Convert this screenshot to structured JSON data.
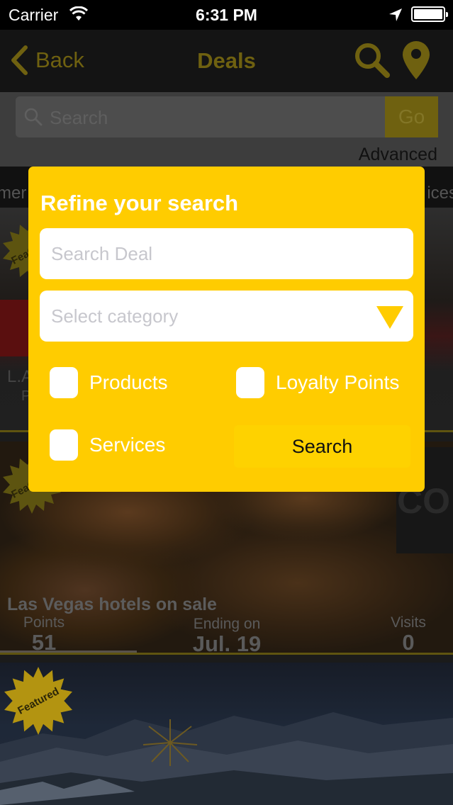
{
  "status_bar": {
    "carrier": "Carrier",
    "time": "6:31 PM",
    "wifi_icon": "wifi-icon",
    "location_icon": "location-arrow-icon",
    "battery_icon": "battery-icon"
  },
  "nav": {
    "back_label": "Back",
    "title": "Deals",
    "search_icon": "search-icon",
    "location_icon": "map-pin-icon"
  },
  "search_bar": {
    "placeholder": "Search",
    "go_label": "Go",
    "advanced_label": "Advanced"
  },
  "category_strip": {
    "left_partial": "mer",
    "right_partial": "ices"
  },
  "deals": [
    {
      "badge": "Featured",
      "title_partial": "L.A",
      "sub_partial": "P"
    },
    {
      "badge": "Featured",
      "title": "Las Vegas hotels on sale",
      "points_label": "Points",
      "points_value": "51",
      "ending_label": "Ending on",
      "ending_value": "Jul. 19",
      "visits_label": "Visits",
      "visits_value": "0",
      "package_text": "CO"
    },
    {
      "badge": "Featured"
    }
  ],
  "modal": {
    "title": "Refine your search",
    "search_placeholder": "Search Deal",
    "category_placeholder": "Select category",
    "dropdown_icon": "triangle-down-icon",
    "options": [
      {
        "label": "Products",
        "checked": false
      },
      {
        "label": "Loyalty Points",
        "checked": false
      },
      {
        "label": "Services",
        "checked": false
      }
    ],
    "search_button": "Search"
  },
  "colors": {
    "accent_yellow": "#ffcc00",
    "button_yellow": "#fed200",
    "dim_yellow": "#6f6110"
  }
}
